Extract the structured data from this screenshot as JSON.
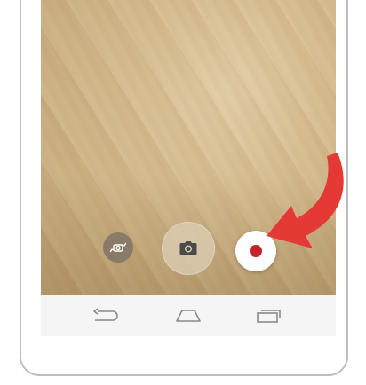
{
  "camera": {
    "controls": [
      {
        "name": "switch-camera",
        "icon": "camera-switch-icon"
      },
      {
        "name": "take-photo",
        "icon": "camera-icon"
      },
      {
        "name": "record-video",
        "icon": "record-dot-icon"
      }
    ]
  },
  "navbar": {
    "buttons": [
      {
        "name": "back",
        "icon": "back-arrow-icon"
      },
      {
        "name": "home",
        "icon": "home-icon"
      },
      {
        "name": "recent-apps",
        "icon": "recent-apps-icon"
      }
    ]
  },
  "annotation": {
    "arrow_color": "#e53935",
    "record_color": "#c4232c"
  }
}
